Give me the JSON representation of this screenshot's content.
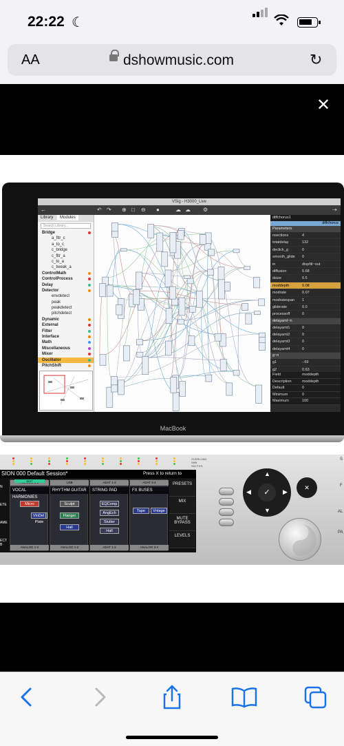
{
  "status_bar": {
    "time": "22:22",
    "icons": [
      "moon-icon",
      "signal-icon",
      "wifi-icon",
      "battery-icon"
    ]
  },
  "address_bar": {
    "text_size_label": "AA",
    "url": "dshowmusic.com",
    "icons": [
      "lock-icon",
      "reload-icon"
    ]
  },
  "viewer": {
    "close_label": "✕"
  },
  "laptop": {
    "brand": "MacBook",
    "window_title": "VSig - H3000_Live",
    "library": {
      "tabs": [
        "Library",
        "Modules"
      ],
      "search_placeholder": "Search Library...",
      "items": [
        {
          "label": "Bridge",
          "level": 0
        },
        {
          "label": "a_fltr_c",
          "level": 1
        },
        {
          "label": "a_to_c",
          "level": 1
        },
        {
          "label": "c_bridge",
          "level": 1
        },
        {
          "label": "c_fltr_a",
          "level": 1
        },
        {
          "label": "c_to_a",
          "level": 1
        },
        {
          "label": "c_tweak_a",
          "level": 1
        },
        {
          "label": "ControlMath",
          "level": 0
        },
        {
          "label": "ControlProcess",
          "level": 0
        },
        {
          "label": "Delay",
          "level": 0
        },
        {
          "label": "Detector",
          "level": 0
        },
        {
          "label": "envdetect",
          "level": 1
        },
        {
          "label": "peak",
          "level": 1
        },
        {
          "label": "peakdetect",
          "level": 1
        },
        {
          "label": "pitchdetect",
          "level": 1
        },
        {
          "label": "Dynamic",
          "level": 0
        },
        {
          "label": "External",
          "level": 0
        },
        {
          "label": "Filter",
          "level": 0
        },
        {
          "label": "Interface",
          "level": 0
        },
        {
          "label": "Math",
          "level": 0
        },
        {
          "label": "Miscellaneous",
          "level": 0
        },
        {
          "label": "Mixer",
          "level": 0
        },
        {
          "label": "Oscillator",
          "level": 0
        },
        {
          "label": "PitchShift",
          "level": 0
        }
      ]
    },
    "params": {
      "module_name": "diffchorus1",
      "module_tag": "diffchorus",
      "group1": "Parameters",
      "rows": [
        {
          "name": "nsections",
          "value": "4"
        },
        {
          "name": "totaldelay",
          "value": "132"
        },
        {
          "name": "declick_g",
          "value": "0"
        },
        {
          "name": "smooth_glide",
          "value": "0"
        },
        {
          "name": "in",
          "value": "dispfilt~out"
        },
        {
          "name": "diffusion",
          "value": "0.68"
        },
        {
          "name": "dsize",
          "value": "0.5"
        },
        {
          "name": "moddepth",
          "value": "0.08"
        },
        {
          "name": "modrate",
          "value": "0.07"
        },
        {
          "name": "modratespan",
          "value": "1"
        },
        {
          "name": "gliderate",
          "value": "0.0"
        },
        {
          "name": "processoff",
          "value": "0"
        }
      ],
      "group2": "delayamt~n",
      "rows2": [
        {
          "name": "delayamt1",
          "value": "0"
        },
        {
          "name": "delayamt2",
          "value": "0"
        },
        {
          "name": "delayamt3",
          "value": "0"
        },
        {
          "name": "delayamt4",
          "value": "0"
        }
      ],
      "group3": "g~n",
      "rows3": [
        {
          "name": "g1",
          "value": "-.69"
        },
        {
          "name": "g2",
          "value": "0.63"
        }
      ],
      "footer": [
        {
          "name": "Field",
          "value": "moddepth"
        },
        {
          "name": "Description",
          "value": "moddepth"
        },
        {
          "name": "Default",
          "value": "0"
        },
        {
          "name": "Minimum",
          "value": "0"
        },
        {
          "name": "Maximum",
          "value": "100"
        }
      ]
    }
  },
  "hardware": {
    "overload": [
      "OVERLOAD",
      "SHR",
      "SIG FX'S"
    ],
    "session_prefix": "SION",
    "session_title": "000 Default Session*",
    "session_hint": "Press X to return to Sessions.",
    "lanes": [
      {
        "top": "ANALOG 1-2",
        "title": "VOCAL HARMONIES",
        "blocks": [
          "Micro",
          "Vox Plate",
          "VlnDel"
        ],
        "bottom": "ANALOG 1-2",
        "tag": "EDIT"
      },
      {
        "top": "USB",
        "title": "RHYTHM GUITAR",
        "blocks": [
          "Sculpt",
          "Flanger",
          "Hall"
        ],
        "bottom": "ANALOG 1-2"
      },
      {
        "top": "ADAT 1-2",
        "title": "STRING PAD",
        "blocks": [
          "EQComp",
          "AngEch",
          "Stutter",
          "Hall"
        ],
        "bottom": "ADAT 1-2"
      },
      {
        "top": "ADAT 3-4",
        "title": "FX BUSES",
        "blocks": [
          "Tape",
          "Vntage"
        ],
        "bottom": "ANALOG 3-4"
      }
    ],
    "side_buttons": [
      "PRESETS",
      "MIX",
      "MUTE BYPASS",
      "LEVELS"
    ],
    "left_cut_labels": [
      "N",
      "ETE",
      "AME",
      "ECT B"
    ],
    "right_cut_labels": [
      "S",
      "F",
      "AL",
      "PA"
    ],
    "nav_icons": [
      "up-arrow-icon",
      "down-arrow-icon",
      "left-arrow-icon",
      "right-arrow-icon",
      "check-icon",
      "x-icon"
    ]
  },
  "browser_toolbar": {
    "icons": [
      "back-icon",
      "forward-icon",
      "share-icon",
      "bookmarks-icon",
      "tabs-icon"
    ]
  }
}
